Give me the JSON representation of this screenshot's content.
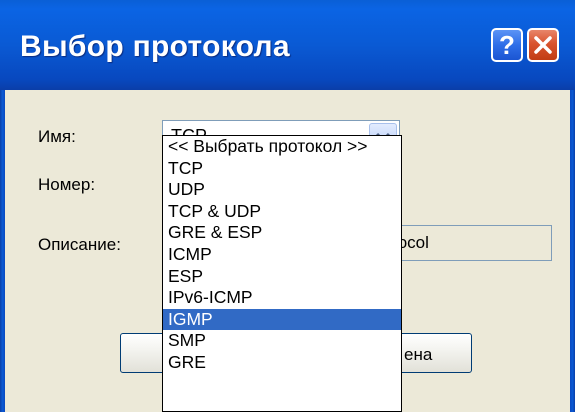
{
  "window": {
    "title": "Выбор протокола",
    "help_label": "?",
    "close_icon": "close-icon"
  },
  "form": {
    "name_label": "Имя:",
    "name_value": "TCP",
    "number_label": "Номер:",
    "description_label": "Описание:",
    "description_value_visible": "tocol"
  },
  "buttons": {
    "cancel_visible": "ена"
  },
  "dropdown": {
    "items": [
      "<< Выбрать протокол >>",
      "TCP",
      "UDP",
      "TCP & UDP",
      "GRE & ESP",
      "ICMP",
      "ESP",
      "IPv6-ICMP",
      "IGMP",
      "SMP",
      "GRE"
    ],
    "selected": "IGMP"
  },
  "colors": {
    "title_bar": "#0a5ad4",
    "dialog_bg": "#ece9d8",
    "selection": "#316ac5",
    "close_button": "#d9532e"
  }
}
